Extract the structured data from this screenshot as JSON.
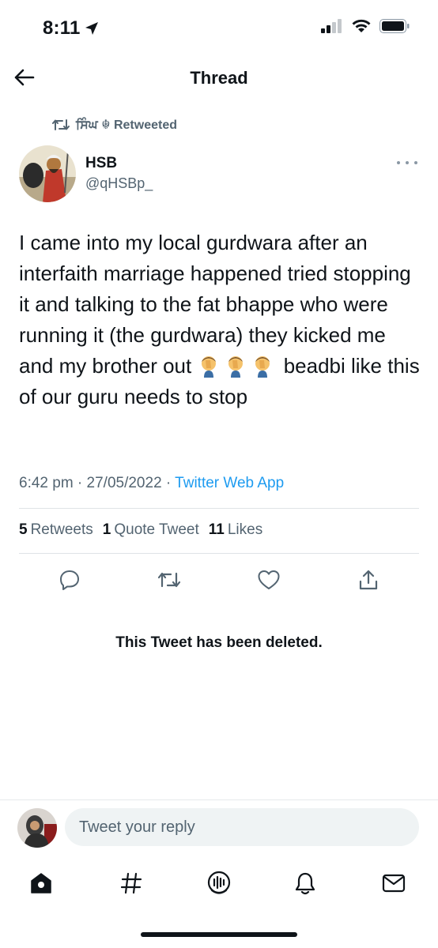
{
  "status_bar": {
    "time": "8:11",
    "icons": [
      "location-arrow-icon",
      "signal-icon",
      "wifi-icon",
      "battery-icon"
    ]
  },
  "header": {
    "title": "Thread",
    "back_icon": "back-arrow-icon"
  },
  "tweet": {
    "retweeted_by": "ਸਿੰਘ ☬ Retweeted",
    "author_name": "HSB",
    "author_handle": "@qHSBp_",
    "text_before_emoji": "I came into my local gurdwara after an interfaith marriage happened tried stopping it and talking to the fat bhappe who were running it (the gurdwara) they kicked me and my brother out ",
    "emoji": "man-facepalming",
    "text_after_emoji": " beadbi like this of our guru needs to stop",
    "timestamp": "6:42 pm · 27/05/2022 · ",
    "source_app": "Twitter Web App",
    "stats": {
      "retweets_count": "5",
      "retweets_label": "Retweets",
      "quotes_count": "1",
      "quotes_label": "Quote Tweet",
      "likes_count": "11",
      "likes_label": "Likes"
    },
    "actions": [
      "reply-icon",
      "retweet-icon",
      "like-icon",
      "share-icon"
    ]
  },
  "quoted": {
    "deleted_notice": "This Tweet has been deleted."
  },
  "reply": {
    "placeholder": "Tweet your reply"
  },
  "tabbar": {
    "tabs": [
      "home-icon",
      "explore-icon",
      "spaces-icon",
      "notifications-icon",
      "messages-icon"
    ],
    "active": "home-icon"
  },
  "colors": {
    "accent": "#1d9bf0",
    "secondary_text": "#536471",
    "primary_text": "#0f1419"
  }
}
